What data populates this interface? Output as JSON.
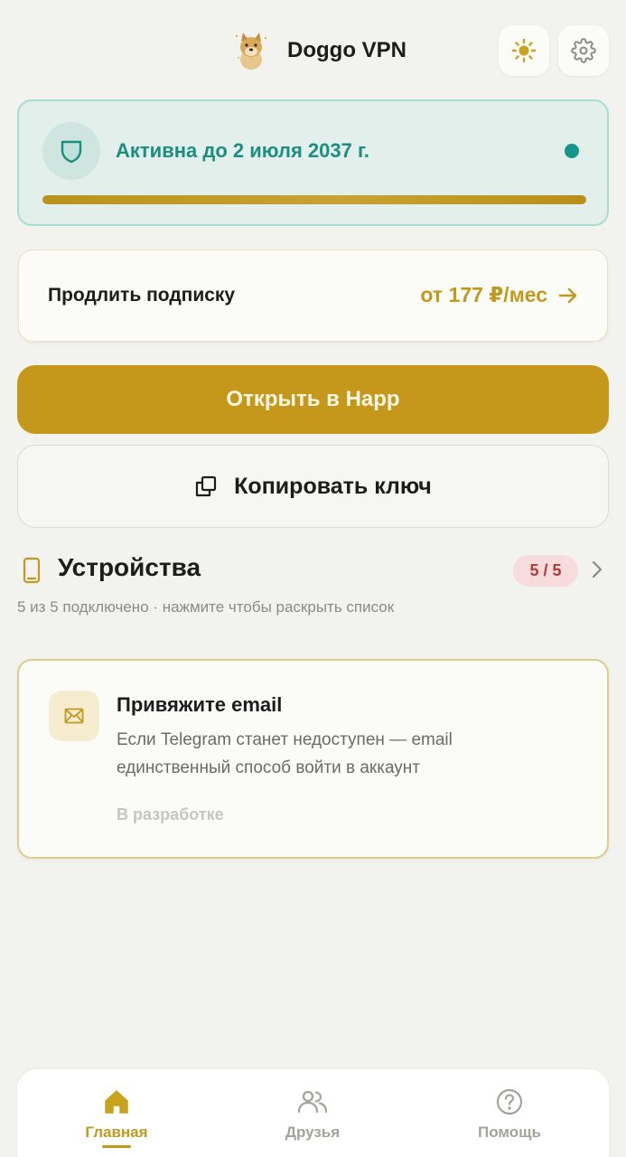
{
  "header": {
    "title": "Doggo VPN",
    "logo_icon": "doge-logo-icon",
    "theme_icon": "sun-icon",
    "settings_icon": "gear-icon"
  },
  "status": {
    "text": "Активна до 2 июля 2037 г.",
    "icon": "shield-icon",
    "progress_fraction": 1.0,
    "accent_color": "#1a8f80"
  },
  "renew": {
    "label": "Продлить подписку",
    "price": "от 177 ₽/мес",
    "icon": "arrow-right-icon"
  },
  "actions": {
    "open_label": "Открыть в Happ",
    "copy_label": "Копировать ключ",
    "copy_icon": "copy-icon",
    "primary_color": "#c5981c"
  },
  "devices": {
    "title": "Устройства",
    "badge": "5 / 5",
    "subtitle": "5 из 5 подключено · нажмите чтобы раскрыть список",
    "icon": "phone-icon"
  },
  "email_card": {
    "title": "Привяжите email",
    "description": "Если Telegram станет недоступен — email единственный способ войти в аккаунт",
    "status": "В разработке",
    "icon": "envelope-icon"
  },
  "nav": {
    "items": [
      {
        "label": "Главная",
        "icon": "home-icon",
        "active": true
      },
      {
        "label": "Друзья",
        "icon": "users-icon",
        "active": false
      },
      {
        "label": "Помощь",
        "icon": "help-icon",
        "active": false
      }
    ]
  }
}
